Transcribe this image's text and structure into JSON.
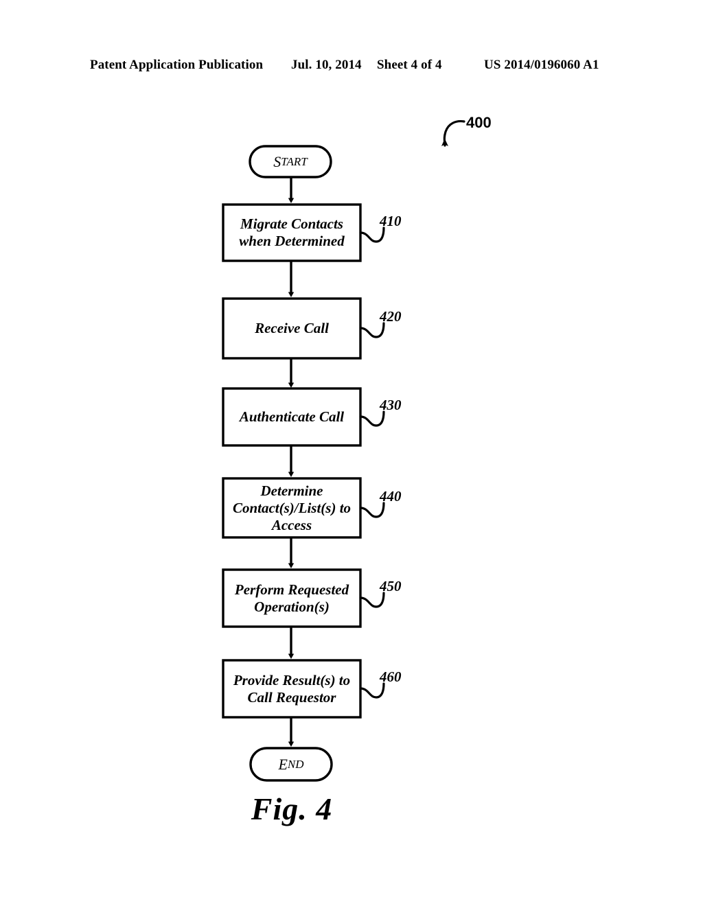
{
  "header": {
    "publication": "Patent Application Publication",
    "date": "Jul. 10, 2014",
    "sheet": "Sheet 4 of 4",
    "document_number": "US 2014/0196060 A1"
  },
  "figure": {
    "caption": "Fig. 4",
    "diagram_ref": "400",
    "type": "flowchart"
  },
  "flowchart": {
    "start_node": {
      "label": "START",
      "shape": "rounded-terminal"
    },
    "end_node": {
      "label": "END",
      "shape": "rounded-terminal"
    },
    "steps": [
      {
        "ref": "410",
        "lines": [
          "Migrate Contacts",
          "when Determined"
        ],
        "text": "Migrate Contacts when Determined"
      },
      {
        "ref": "420",
        "lines": [
          "Receive Call"
        ],
        "text": "Receive Call"
      },
      {
        "ref": "430",
        "lines": [
          "Authenticate Call"
        ],
        "text": "Authenticate Call"
      },
      {
        "ref": "440",
        "lines": [
          "Determine",
          "Contact(s)/List(s) to",
          "Access"
        ],
        "text": "Determine Contact(s)/List(s) to Access"
      },
      {
        "ref": "450",
        "lines": [
          "Perform Requested",
          "Operation(s)"
        ],
        "text": "Perform Requested Operation(s)"
      },
      {
        "ref": "460",
        "lines": [
          "Provide Result(s) to",
          "Call Requestor"
        ],
        "text": "Provide Result(s) to Call Requestor"
      }
    ]
  },
  "colors": {
    "ink": "#000000",
    "paper": "#ffffff"
  }
}
